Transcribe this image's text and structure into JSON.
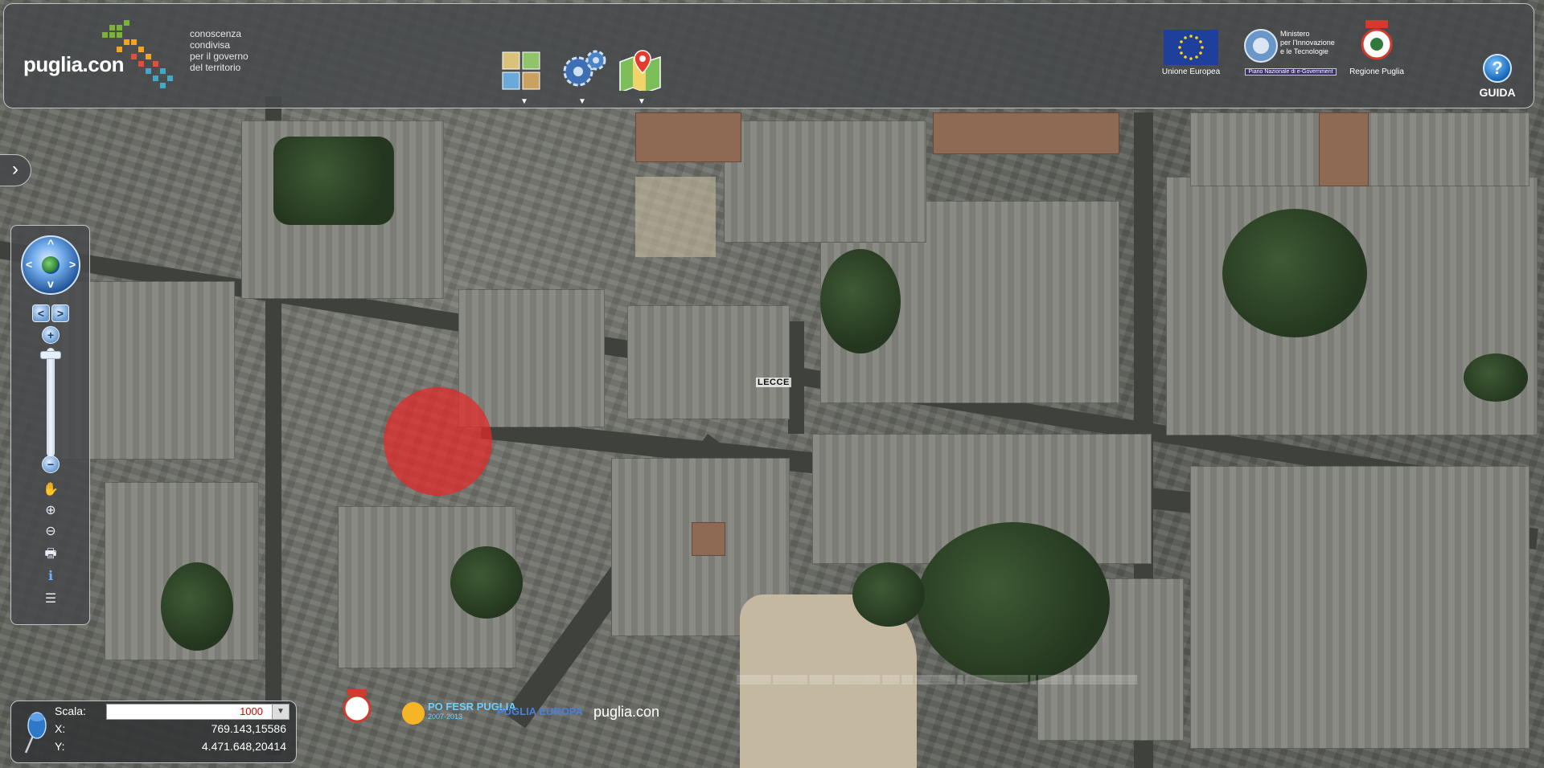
{
  "header": {
    "logo_text": "puglia.con",
    "tagline": [
      "conoscenza",
      "condivisa",
      "per il governo",
      "del territorio"
    ],
    "tools": [
      {
        "icon": "layers-icon"
      },
      {
        "icon": "settings-gears-icon"
      },
      {
        "icon": "map-marker-icon"
      }
    ],
    "tool_arrow": "▼",
    "sponsors": {
      "eu_label": "Unione Europea",
      "ministero_lines": [
        "Ministero",
        "per l'Innovazione",
        "e le Tecnologie"
      ],
      "ministero_sub": "Piano Nazionale di e-Government",
      "regione_label": "Regione Puglia"
    },
    "guida_label": "GUIDA",
    "guida_icon": "?"
  },
  "side_toggle": "›",
  "map": {
    "place_label": "LECCE",
    "marker_color": "#e62828"
  },
  "nav": {
    "pan_arrows": {
      "up": "^",
      "down": "v",
      "left": "<",
      "right": ">"
    },
    "prev": "<",
    "next": ">",
    "zoom_in": "+",
    "zoom_out": "−",
    "zoom_level": 0.03,
    "tools": [
      {
        "icon": "pan-hand-icon",
        "glyph": "✋"
      },
      {
        "icon": "zoom-in-icon",
        "glyph": "⊕"
      },
      {
        "icon": "zoom-out-icon",
        "glyph": "⊖"
      },
      {
        "icon": "print-icon",
        "glyph": "🖶"
      },
      {
        "icon": "info-icon",
        "glyph": "ℹ"
      },
      {
        "icon": "legend-icon",
        "glyph": "☰"
      }
    ]
  },
  "coords": {
    "scale_label": "Scala:",
    "scale_value": "1000",
    "x_label": "X:",
    "x_value": "769.143,15586",
    "y_label": "Y:",
    "y_value": "4.471.648,20414"
  },
  "footer": {
    "po_fesr": "PO FESR PUGLIA",
    "po_fesr_years": "2007-2013",
    "puglia_europa": "PUGLIA EUROPA",
    "pugliacon": "puglia.con"
  }
}
